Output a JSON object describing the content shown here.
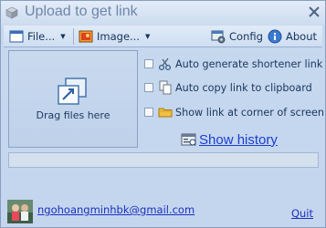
{
  "window": {
    "title": "Upload to get link"
  },
  "toolbar": {
    "file_label": "File...",
    "image_label": "Image...",
    "config_label": "Config",
    "about_label": "About"
  },
  "dropzone": {
    "label": "Drag files here"
  },
  "options": [
    {
      "label": "Auto generate shortener link",
      "checked": false,
      "icon": "scissors-icon"
    },
    {
      "label": "Auto copy link to clipboard",
      "checked": false,
      "icon": "copy-icon"
    },
    {
      "label": "Show link at corner of screen",
      "checked": false,
      "icon": "folder-icon"
    }
  ],
  "history": {
    "label": "Show history"
  },
  "progress": {
    "value": 0
  },
  "footer": {
    "email": "ngohoangminhbk@gmail.com",
    "quit_label": "Quit"
  },
  "colors": {
    "window_bg": "#c4d6ed",
    "link": "#1c2fc0",
    "history_link": "#1a3ed0",
    "title_text": "#6f86a8"
  }
}
